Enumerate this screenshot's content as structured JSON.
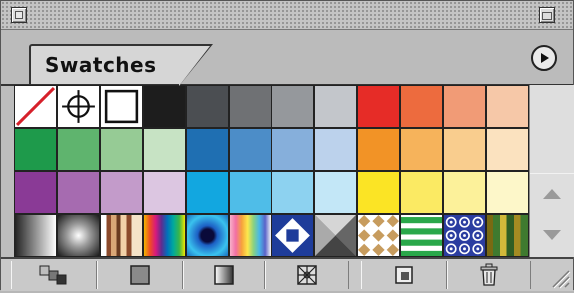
{
  "panel": {
    "tab_label": "Swatches",
    "title_bar": {
      "close_icon": "close-box-icon",
      "zoom_icon": "zoom-box-icon"
    },
    "menu_icon": "triangle-right-circle-icon"
  },
  "colors": {
    "panel_bg": "#bdbdbd",
    "tab_bg": "#d6d6d6",
    "grid_border": "#222222"
  },
  "swatches": {
    "row1": [
      {
        "name": "none",
        "color": "#ffffff"
      },
      {
        "name": "registration",
        "color": "#ffffff"
      },
      {
        "name": "white",
        "color": "#ffffff"
      },
      {
        "name": "black",
        "color": "#1d1d1d"
      },
      {
        "name": "gray-1",
        "color": "#4b4e52"
      },
      {
        "name": "gray-2",
        "color": "#6f7174"
      },
      {
        "name": "gray-3",
        "color": "#95989c"
      },
      {
        "name": "gray-4",
        "color": "#c3c6cb"
      },
      {
        "name": "red",
        "color": "#e62c27"
      },
      {
        "name": "orange-red",
        "color": "#ed6b3e"
      },
      {
        "name": "salmon",
        "color": "#f19b76"
      },
      {
        "name": "peach",
        "color": "#f6c8a8"
      }
    ],
    "row2": [
      {
        "name": "green",
        "color": "#1e9a4b"
      },
      {
        "name": "green-2",
        "color": "#5fb46e"
      },
      {
        "name": "green-3",
        "color": "#96cb95"
      },
      {
        "name": "green-4",
        "color": "#c7e3c4"
      },
      {
        "name": "blue",
        "color": "#1f6fb2"
      },
      {
        "name": "blue-2",
        "color": "#4c8dc8"
      },
      {
        "name": "blue-3",
        "color": "#86afdb"
      },
      {
        "name": "blue-4",
        "color": "#bcd2ec"
      },
      {
        "name": "orange",
        "color": "#f29326"
      },
      {
        "name": "orange-2",
        "color": "#f6b35b"
      },
      {
        "name": "orange-3",
        "color": "#f9cd8e"
      },
      {
        "name": "orange-4",
        "color": "#fbe2bf"
      }
    ],
    "row3": [
      {
        "name": "purple",
        "color": "#8a3a96"
      },
      {
        "name": "purple-2",
        "color": "#a66bb0"
      },
      {
        "name": "purple-3",
        "color": "#c39bca"
      },
      {
        "name": "purple-4",
        "color": "#dcc6e1"
      },
      {
        "name": "cyan",
        "color": "#12a7e0"
      },
      {
        "name": "cyan-2",
        "color": "#4fbde8"
      },
      {
        "name": "cyan-3",
        "color": "#8dd2f0"
      },
      {
        "name": "cyan-4",
        "color": "#c3e7f7"
      },
      {
        "name": "yellow",
        "color": "#fbe425"
      },
      {
        "name": "yellow-2",
        "color": "#fbea63"
      },
      {
        "name": "yellow-3",
        "color": "#fcf19a"
      },
      {
        "name": "yellow-4",
        "color": "#fdf7c9"
      }
    ],
    "row4": [
      {
        "name": "gradient-linear-gray",
        "pattern": "linear-gray"
      },
      {
        "name": "gradient-radial-gray",
        "pattern": "radial-gray"
      },
      {
        "name": "gradient-wood-stripes",
        "pattern": "wood"
      },
      {
        "name": "gradient-spectrum",
        "pattern": "spectrum"
      },
      {
        "name": "gradient-radial-blue",
        "pattern": "radial-blue"
      },
      {
        "name": "gradient-rainbow",
        "pattern": "rainbow"
      },
      {
        "name": "pattern-blue-diamond",
        "pattern": "diamond"
      },
      {
        "name": "pattern-pyramid",
        "pattern": "pyramid"
      },
      {
        "name": "pattern-tan-tiles",
        "pattern": "tan-tiles"
      },
      {
        "name": "pattern-green-stripes",
        "pattern": "green-stripes"
      },
      {
        "name": "pattern-blue-tiles",
        "pattern": "blue-tiles"
      },
      {
        "name": "pattern-camo",
        "pattern": "camo"
      }
    ]
  },
  "bottom_buttons": [
    {
      "name": "show-all-swatches-button",
      "icon": "stacked-squares-icon"
    },
    {
      "name": "show-color-swatches-button",
      "icon": "gray-square-icon"
    },
    {
      "name": "show-gradient-swatches-button",
      "icon": "gradient-square-icon"
    },
    {
      "name": "show-pattern-swatches-button",
      "icon": "pattern-square-icon"
    },
    {
      "name": "new-swatch-button",
      "icon": "new-page-icon"
    },
    {
      "name": "delete-swatch-button",
      "icon": "trash-icon"
    }
  ]
}
